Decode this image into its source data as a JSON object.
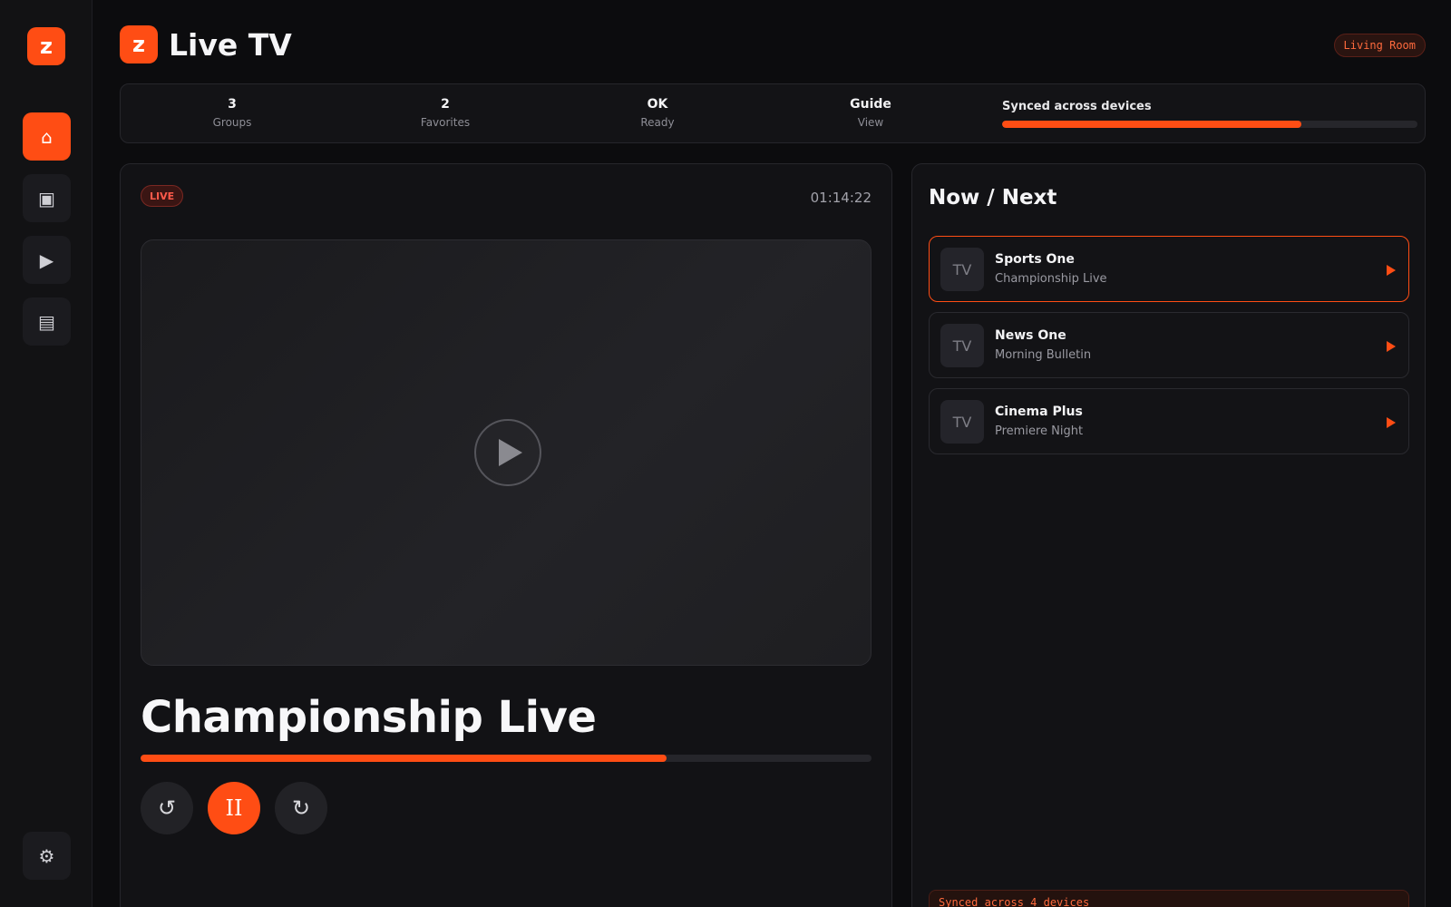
{
  "app": {
    "logo_letter": "z",
    "title": "Live TV",
    "room": "Living Room"
  },
  "sidebar": {
    "items": [
      {
        "name": "home",
        "icon": "home-icon",
        "glyph": "⌂",
        "active": true
      },
      {
        "name": "grid",
        "icon": "grid-icon",
        "glyph": "▣",
        "active": false
      },
      {
        "name": "play",
        "icon": "play-icon",
        "glyph": "▶",
        "active": false
      },
      {
        "name": "list",
        "icon": "list-icon",
        "glyph": "▤",
        "active": false
      }
    ],
    "settings_glyph": "⚙"
  },
  "stats": [
    {
      "value": "3",
      "label": "Groups"
    },
    {
      "value": "2",
      "label": "Favorites"
    },
    {
      "value": "OK",
      "label": "Ready"
    },
    {
      "value": "Guide",
      "label": "View"
    }
  ],
  "sync": {
    "label": "Synced across devices",
    "progress": 0.72
  },
  "player": {
    "live_label": "LIVE",
    "timecode": "01:14:22",
    "title": "Championship Live",
    "progress": 0.72,
    "controls": {
      "rewind": "↺",
      "pause": "II",
      "forward": "↻"
    }
  },
  "guide": {
    "title": "Now / Next",
    "channels": [
      {
        "thumb": "TV",
        "name": "Sports One",
        "program": "Championship Live",
        "active": true
      },
      {
        "thumb": "TV",
        "name": "News One",
        "program": "Morning Bulletin",
        "active": false
      },
      {
        "thumb": "TV",
        "name": "Cinema Plus",
        "program": "Premiere Night",
        "active": false
      }
    ],
    "sync_note": "Synced across 4 devices"
  },
  "colors": {
    "accent": "#ff4d14",
    "background": "#0c0c0e",
    "panel": "#121215",
    "live": "#ff5a4a"
  }
}
